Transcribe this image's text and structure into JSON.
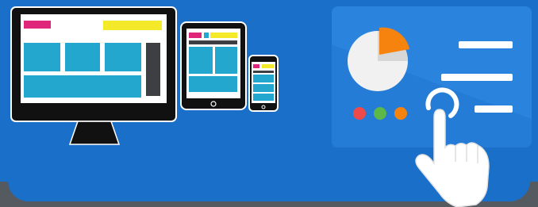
{
  "illustration": {
    "background_color": "#1a6fc9",
    "devices": [
      "desktop-monitor-icon",
      "tablet-icon",
      "phone-icon"
    ],
    "dashboard": {
      "pie_chart_highlight_color": "#f7830f",
      "indicator_dots": [
        "#ef4a4a",
        "#5cb848",
        "#f7830f"
      ],
      "legend_lines": 3
    },
    "hand_icon": "pointing-hand-icon"
  }
}
